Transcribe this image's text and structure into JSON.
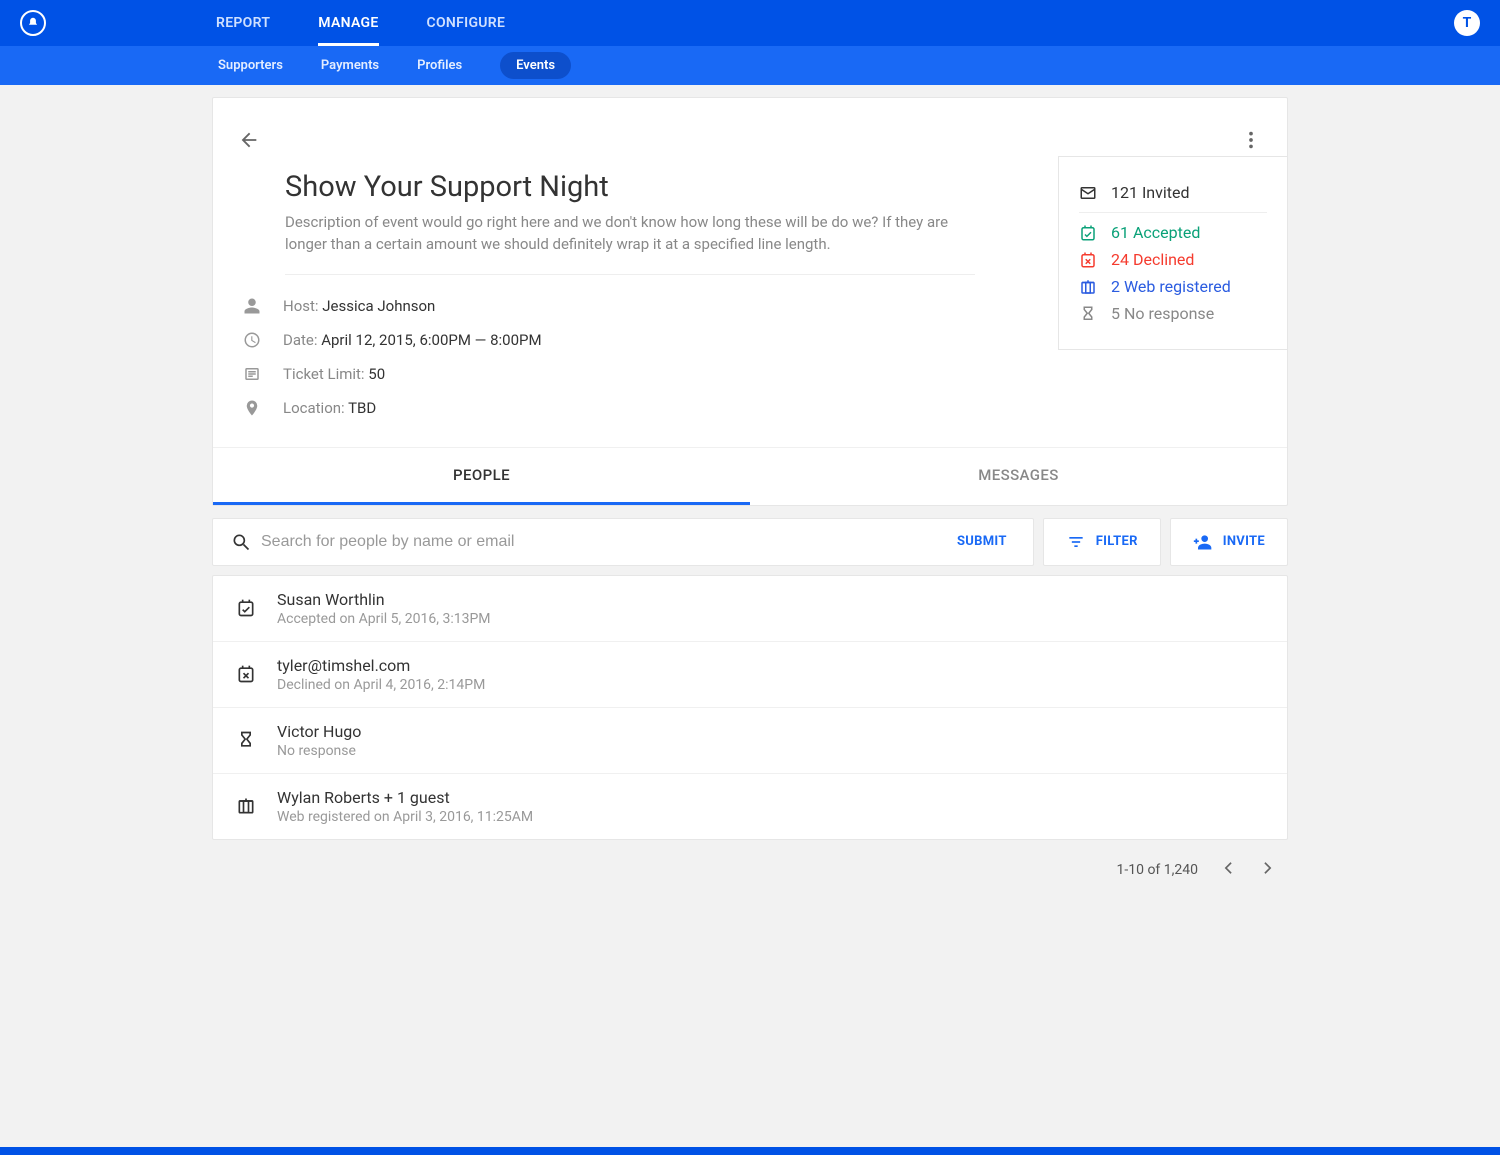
{
  "header": {
    "avatar_initial": "T",
    "nav": [
      "REPORT",
      "MANAGE",
      "CONFIGURE"
    ],
    "active_nav_index": 1
  },
  "subnav": {
    "items": [
      "Supporters",
      "Payments",
      "Profiles",
      "Events"
    ],
    "active_index": 3
  },
  "event": {
    "title": "Show Your Support Night",
    "description": "Description of event would go right here and we don't know how long these will be do we? If they are longer than a certain amount we should definitely wrap it at a specified line length.",
    "host_label": "Host: ",
    "host_value": "Jessica Johnson",
    "date_label": "Date: ",
    "date_value": "April 12, 2015, 6:00PM — 8:00PM",
    "ticket_label": "Ticket Limit: ",
    "ticket_value": "50",
    "location_label": "Location: ",
    "location_value": "TBD"
  },
  "stats": {
    "invited": "121 Invited",
    "accepted": "61 Accepted",
    "declined": "24 Declined",
    "webreg": "2 Web registered",
    "noresp": "5 No response"
  },
  "tabs": {
    "people": "PEOPLE",
    "messages": "MESSAGES"
  },
  "search": {
    "placeholder": "Search for people by name or email",
    "submit": "SUBMIT",
    "filter": "FILTER",
    "invite": "INVITE"
  },
  "people": [
    {
      "name": "Susan Worthlin",
      "sub": "Accepted on April 5, 2016, 3:13PM",
      "status": "accepted"
    },
    {
      "name": "tyler@timshel.com",
      "sub": "Declined on April 4, 2016, 2:14PM",
      "status": "declined"
    },
    {
      "name": "Victor Hugo",
      "sub": "No response",
      "status": "noresp"
    },
    {
      "name": "Wylan Roberts + 1 guest",
      "sub": "Web registered on April 3, 2016, 11:25AM",
      "status": "webreg"
    }
  ],
  "pagination": {
    "range": "1-10 of 1,240"
  }
}
